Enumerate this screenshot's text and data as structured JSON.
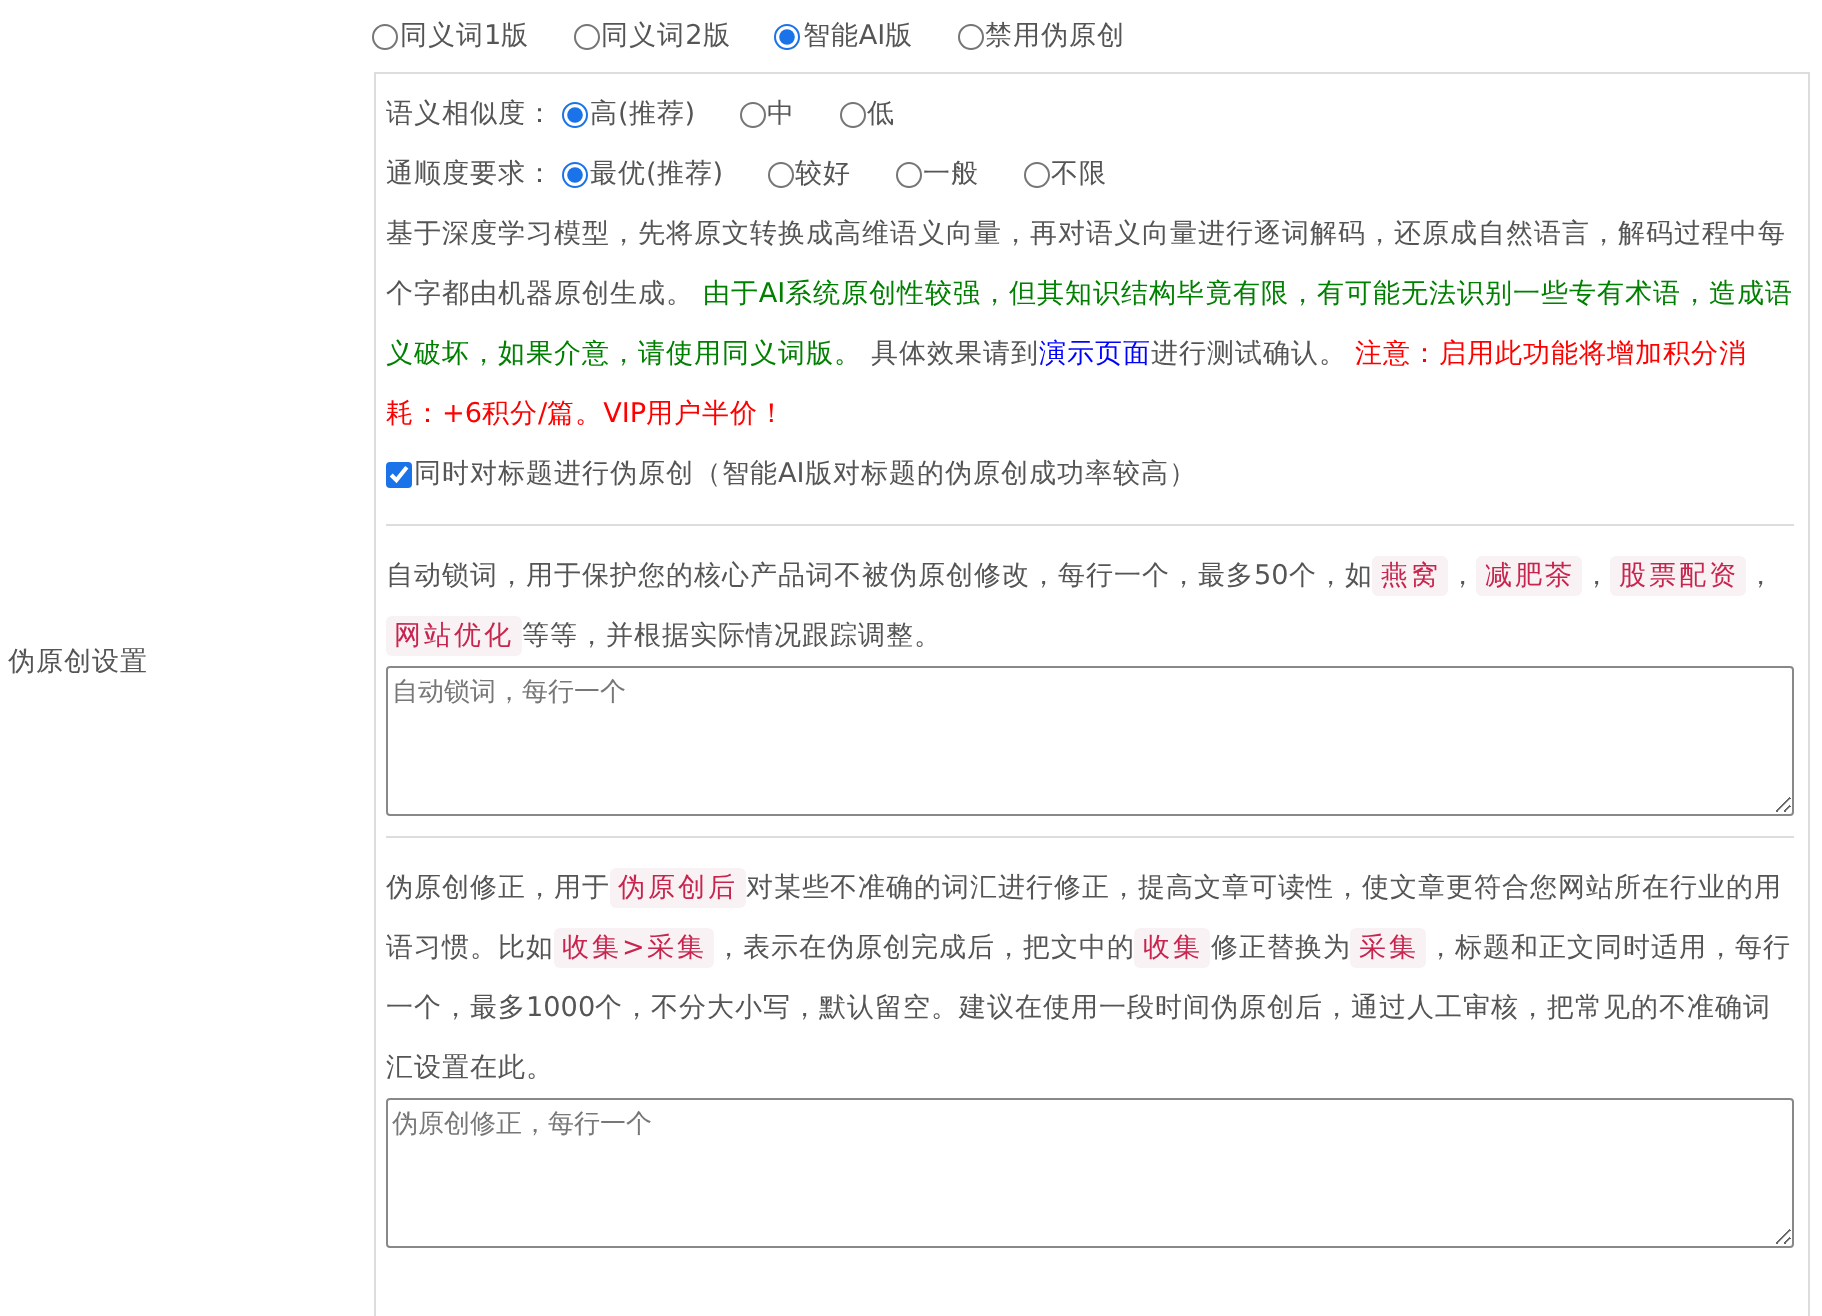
{
  "sidebar_label": "伪原创设置",
  "modes": [
    {
      "label": "同义词1版",
      "selected": false
    },
    {
      "label": "同义词2版",
      "selected": false
    },
    {
      "label": "智能AI版",
      "selected": true
    },
    {
      "label": "禁用伪原创",
      "selected": false
    }
  ],
  "semantic_similarity": {
    "label": "语义相似度：",
    "options": [
      {
        "label": "高(推荐)",
        "selected": true
      },
      {
        "label": "中",
        "selected": false
      },
      {
        "label": "低",
        "selected": false
      }
    ]
  },
  "fluency": {
    "label": "通顺度要求：",
    "options": [
      {
        "label": "最优(推荐)",
        "selected": true
      },
      {
        "label": "较好",
        "selected": false
      },
      {
        "label": "一般",
        "selected": false
      },
      {
        "label": "不限",
        "selected": false
      }
    ]
  },
  "ai_description": [
    {
      "kind": "plain",
      "text": "基于深度学习模型，先将原文转换成高维语义向量，再对语义向量进行逐词解码，还原成自然语言，解码过程中每个字都由机器原创生成。 "
    },
    {
      "kind": "notice",
      "text": "由于AI系统原创性较强，但其知识结构毕竟有限，有可能无法识别一些专有术语，造成语义破坏，如果介意，请使用同义词版。"
    },
    {
      "kind": "plain",
      "text": " 具体效果请到"
    },
    {
      "kind": "link",
      "text": "演示页面"
    },
    {
      "kind": "plain",
      "text": "进行测试确认。 "
    },
    {
      "kind": "warning",
      "text": "注意：启用此功能将增加积分消耗：+6积分/篇。VIP用户半价！"
    }
  ],
  "title_option": {
    "label": "同时对标题进行伪原创（智能AI版对标题的伪原创成功率较高）",
    "checked": true
  },
  "lock_words": {
    "description": [
      {
        "kind": "plain",
        "text": "自动锁词，用于保护您的核心产品词不被伪原创修改，每行一个，最多50个，如"
      },
      {
        "kind": "tag",
        "text": "燕窝"
      },
      {
        "kind": "plain",
        "text": "，"
      },
      {
        "kind": "tag",
        "text": "减肥茶"
      },
      {
        "kind": "plain",
        "text": "，"
      },
      {
        "kind": "tag",
        "text": "股票配资"
      },
      {
        "kind": "plain",
        "text": "，"
      },
      {
        "kind": "tag",
        "text": "网站优化"
      },
      {
        "kind": "plain",
        "text": "等等，并根据实际情况跟踪调整。"
      }
    ],
    "placeholder": "自动锁词，每行一个"
  },
  "correction": {
    "description": [
      {
        "kind": "plain",
        "text": "伪原创修正，用于"
      },
      {
        "kind": "tag",
        "text": "伪原创后"
      },
      {
        "kind": "plain",
        "text": "对某些不准确的词汇进行修正，提高文章可读性，使文章更符合您网站所在行业的用语习惯。比如"
      },
      {
        "kind": "tag",
        "text": "收集>采集"
      },
      {
        "kind": "plain",
        "text": "，表示在伪原创完成后，把文中的"
      },
      {
        "kind": "tag",
        "text": "收集"
      },
      {
        "kind": "plain",
        "text": "修正替换为"
      },
      {
        "kind": "tag",
        "text": "采集"
      },
      {
        "kind": "plain",
        "text": "，标题和正文同时适用，每行一个，最多1000个，不分大小写，默认留空。建议在使用一段时间伪原创后，通过人工审核，把常见的不准确词汇设置在此。"
      }
    ],
    "placeholder": "伪原创修正，每行一个"
  }
}
